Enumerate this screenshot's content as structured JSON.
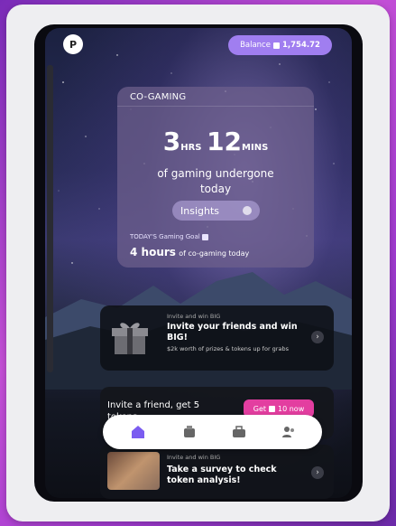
{
  "profile": {
    "initial": "P"
  },
  "balance": {
    "label": "Balance",
    "amount": "1,754.72"
  },
  "co_gaming": {
    "header": "CO-GAMING",
    "hours": "3",
    "hours_unit": "HRS",
    "minutes": "12",
    "minutes_unit": "MINS",
    "caption_line1": "of gaming undergone",
    "caption_line2": "today",
    "insights_label": "Insights",
    "goal_label": "TODAY'S Gaming Goal",
    "goal_value": "4 hours",
    "goal_suffix": "of co-gaming today"
  },
  "invite_card": {
    "small_label": "Invite and win BIG",
    "title": "Invite your friends and win BIG!",
    "description": "$2k worth of prizes & tokens up for grabs"
  },
  "promo": {
    "text": "Invite a friend, get 5 tokens",
    "button_label": "Get",
    "button_value": "10 now"
  },
  "survey_card": {
    "small_label": "Invite and win BIG",
    "title": "Take a survey to check token analysis!"
  },
  "nav": {
    "items": [
      "home-icon",
      "controller-icon",
      "briefcase-icon",
      "users-icon"
    ],
    "accent": "#7b5cf0"
  },
  "colors": {
    "balance_pill": "#a07ef0",
    "promo_button": "#e33ea0"
  }
}
